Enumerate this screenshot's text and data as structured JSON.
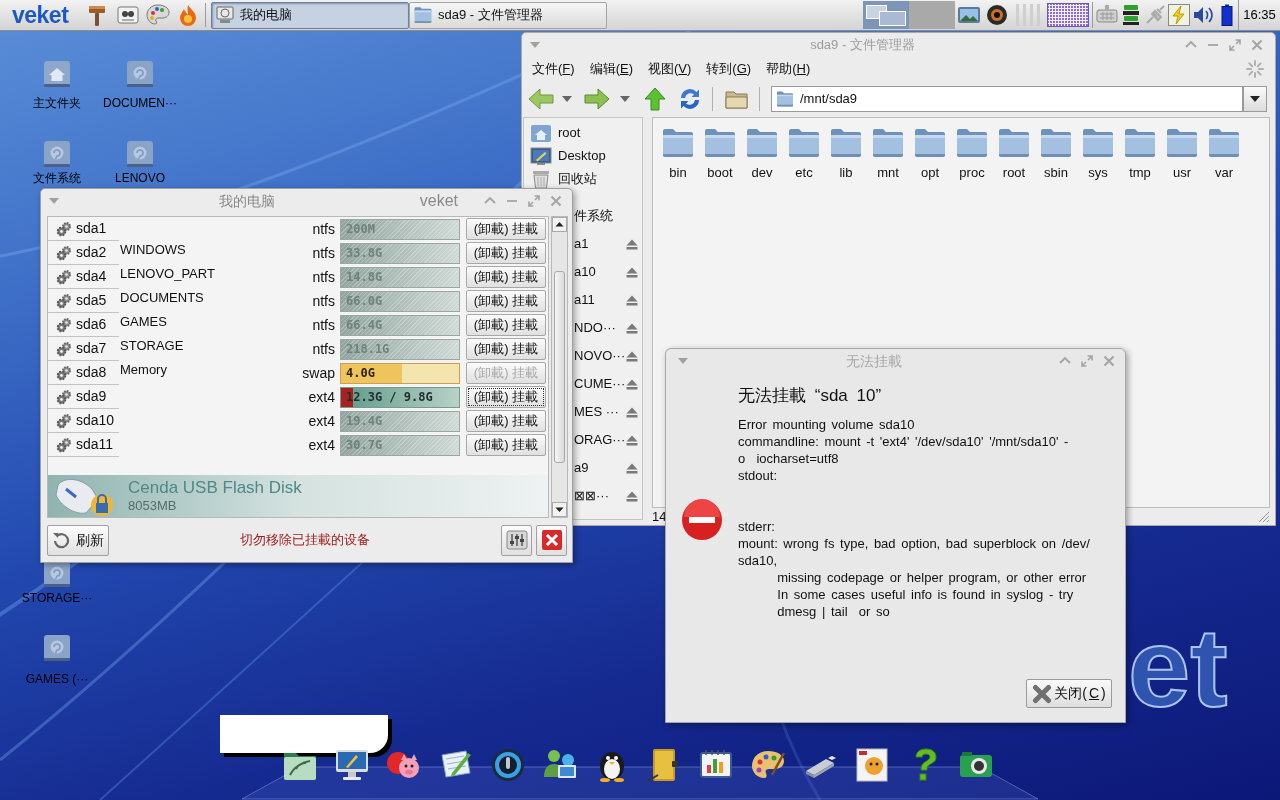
{
  "taskbar": {
    "logo": "veket",
    "tasks": [
      {
        "label": "我的电脑",
        "kind": "computer",
        "selected": true
      },
      {
        "label": "sda9 - 文件管理器",
        "kind": "folder",
        "selected": false
      }
    ],
    "clock": "16:35"
  },
  "desktop": {
    "icons": [
      {
        "label": "主文件夹",
        "kind": "home"
      },
      {
        "label": "DOCUMEN···",
        "kind": "drive"
      },
      {
        "label": "文件系统",
        "kind": "drive"
      },
      {
        "label": "LENOVO",
        "kind": "drive"
      },
      {
        "label": "STORAGE···",
        "kind": "drive"
      },
      {
        "label": "GAMES (···",
        "kind": "drive"
      }
    ],
    "wallpaper_text": "et"
  },
  "file_manager": {
    "title": "sda9 - 文件管理器",
    "menu": [
      {
        "text": "文件(",
        "mnemonic": "F",
        "after": ")"
      },
      {
        "text": "编辑(",
        "mnemonic": "E",
        "after": ")"
      },
      {
        "text": "视图(",
        "mnemonic": "V",
        "after": ")"
      },
      {
        "text": "转到(",
        "mnemonic": "G",
        "after": ")"
      },
      {
        "text": "帮助(",
        "mnemonic": "H",
        "after": ")"
      }
    ],
    "location": "/mnt/sda9",
    "places": [
      {
        "label": "root",
        "kind": "home"
      },
      {
        "label": "Desktop",
        "kind": "desktop"
      },
      {
        "label": "回收站",
        "kind": "trash"
      },
      {
        "label": "件系统",
        "kind": "filesystem"
      },
      {
        "label": "a1",
        "kind": "volume"
      },
      {
        "label": "a10",
        "kind": "volume"
      },
      {
        "label": "a11",
        "kind": "volume"
      },
      {
        "label": "NDO···",
        "kind": "volume"
      },
      {
        "label": "NOVO···",
        "kind": "volume"
      },
      {
        "label": "CUME···",
        "kind": "volume"
      },
      {
        "label": "MES ···",
        "kind": "volume"
      },
      {
        "label": "ORAG···",
        "kind": "volume"
      },
      {
        "label": "a9",
        "kind": "volume"
      },
      {
        "label": "⊠⊠···",
        "kind": "volume"
      }
    ],
    "files": [
      "bin",
      "boot",
      "dev",
      "etc",
      "lib",
      "mnt",
      "opt",
      "proc",
      "root",
      "sbin",
      "sys",
      "tmp",
      "usr",
      "var"
    ],
    "status": "14"
  },
  "my_computer": {
    "title": "我的电脑",
    "brand": "veket",
    "partitions": [
      {
        "device": "sda1",
        "fs": "ntfs",
        "size": "200M",
        "kind": "idle",
        "action": "(卸載) 挂載",
        "disabled": false,
        "focused": false
      },
      {
        "device": "sda2",
        "label": "WINDOWS",
        "fs": "ntfs",
        "size": "33.8G",
        "kind": "idle",
        "action": "(卸載) 挂載",
        "disabled": false,
        "focused": false
      },
      {
        "device": "sda4",
        "label": "LENOVO_PART",
        "fs": "ntfs",
        "size": "14.8G",
        "kind": "idle",
        "action": "(卸載) 挂載",
        "disabled": false,
        "focused": false
      },
      {
        "device": "sda5",
        "label": "DOCUMENTS",
        "fs": "ntfs",
        "size": "66.0G",
        "kind": "idle",
        "action": "(卸載) 挂載",
        "disabled": false,
        "focused": false
      },
      {
        "device": "sda6",
        "label": "GAMES",
        "fs": "ntfs",
        "size": "66.4G",
        "kind": "idle",
        "action": "(卸載) 挂載",
        "disabled": false,
        "focused": false
      },
      {
        "device": "sda7",
        "label": "STORAGE",
        "fs": "ntfs",
        "size": "218.1G",
        "kind": "idle",
        "action": "(卸載) 挂載",
        "disabled": false,
        "focused": false
      },
      {
        "device": "sda8",
        "label": "Memory",
        "fs": "swap",
        "size": "4.0G",
        "kind": "swap",
        "level": 0.52,
        "action": "(卸載) 挂載",
        "disabled": true,
        "focused": false
      },
      {
        "device": "sda9",
        "fs": "ext4",
        "size": "12.3G / 9.8G",
        "kind": "mounted",
        "level": 0.1,
        "action": "(卸載) 挂載",
        "disabled": false,
        "focused": true
      },
      {
        "device": "sda10",
        "fs": "ext4",
        "size": "19.4G",
        "kind": "idle",
        "action": "(卸載) 挂載",
        "disabled": false,
        "focused": false
      },
      {
        "device": "sda11",
        "fs": "ext4",
        "size": "30.7G",
        "kind": "idle",
        "action": "(卸載) 挂載",
        "disabled": false,
        "focused": false
      }
    ],
    "usb": {
      "name": "Cenda USB Flash Disk",
      "size": "8053MB"
    },
    "refresh": "刷新",
    "warning": "切勿移除已挂載的设备"
  },
  "error_dialog": {
    "title": "无法挂載",
    "heading": "无法挂載 “sda 10”",
    "stdout_block": "Error mounting volume sda10\ncommandline: mount -t 'ext4' '/dev/sda10' '/mnt/sda10' -\no  iocharset=utf8\nstdout:",
    "stderr_block": "stderr:\nmount: wrong fs type, bad option, bad superblock on /dev/\nsda10,\n       missing codepage or helper program, or other error\n       In some cases useful info is found in syslog - try\n       dmesg | tail  or so",
    "close": {
      "text": "关闭(",
      "mnemonic": "C",
      "after": ")"
    }
  }
}
